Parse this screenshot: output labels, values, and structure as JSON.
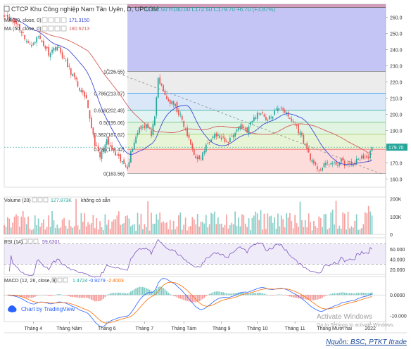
{
  "header": {
    "title": "CTCP Khu Công nghiệp Nam Tân Uyên, D, UPCOM",
    "ohlc": "O172.50  H180.00  L172.50  C179.70  +6.70 (+3.87%)",
    "ma1_label": "MA (20, close, 0)",
    "ma1_value": "171.3150",
    "ma2_label": "MA (50, close, 0)",
    "ma2_value": "180.6213"
  },
  "colors": {
    "up": "#26a69a",
    "down": "#ef5350",
    "ma20": "#3d4bd1",
    "ma50": "#d55e5e",
    "macd": "#2962ff",
    "signal": "#ff6d00",
    "rsi": "#7e57c2"
  },
  "chart_data": [
    {
      "type": "candlestick",
      "title": "CTCP Khu Công nghiệp Nam Tân Uyên, D, UPCOM",
      "ylim": [
        155,
        268
      ],
      "yticks": [
        160,
        170,
        180,
        190,
        200,
        210,
        220,
        230,
        240,
        250,
        260
      ],
      "last_price": 179.7,
      "fib_levels": [
        {
          "ratio": "0",
          "label": "0(163.56)",
          "price": 163.56
        },
        {
          "ratio": "0.236",
          "label": "0.236(178.42)",
          "price": 178.42
        },
        {
          "ratio": "0.382",
          "label": "0.382(187.62)",
          "price": 187.62
        },
        {
          "ratio": "0.5",
          "label": "0.5(195.06)",
          "price": 195.06
        },
        {
          "ratio": "0.618",
          "label": "0.618(202.49)",
          "price": 202.49
        },
        {
          "ratio": "0.786",
          "label": "0.786(213.07)",
          "price": 213.07
        },
        {
          "ratio": "1",
          "label": "1(226.55)",
          "price": 226.55
        }
      ],
      "anchors": [
        {
          "t": 0,
          "p": 262
        },
        {
          "t": 8,
          "p": 255
        },
        {
          "t": 15,
          "p": 242
        },
        {
          "t": 20,
          "p": 248
        },
        {
          "t": 26,
          "p": 238
        },
        {
          "t": 31,
          "p": 242
        },
        {
          "t": 37,
          "p": 230
        },
        {
          "t": 42,
          "p": 220
        },
        {
          "t": 48,
          "p": 208
        },
        {
          "t": 53,
          "p": 182
        },
        {
          "t": 56,
          "p": 174
        },
        {
          "t": 60,
          "p": 183
        },
        {
          "t": 64,
          "p": 176
        },
        {
          "t": 69,
          "p": 170
        },
        {
          "t": 72,
          "p": 168
        },
        {
          "t": 75,
          "p": 180
        },
        {
          "t": 79,
          "p": 192
        },
        {
          "t": 83,
          "p": 193
        },
        {
          "t": 86,
          "p": 188
        },
        {
          "t": 88,
          "p": 197
        },
        {
          "t": 90,
          "p": 222
        },
        {
          "t": 93,
          "p": 214
        },
        {
          "t": 96,
          "p": 208
        },
        {
          "t": 100,
          "p": 205
        },
        {
          "t": 104,
          "p": 196
        },
        {
          "t": 108,
          "p": 184
        },
        {
          "t": 111,
          "p": 176
        },
        {
          "t": 114,
          "p": 171
        },
        {
          "t": 118,
          "p": 180
        },
        {
          "t": 122,
          "p": 188
        },
        {
          "t": 126,
          "p": 186
        },
        {
          "t": 130,
          "p": 182
        },
        {
          "t": 134,
          "p": 188
        },
        {
          "t": 138,
          "p": 193
        },
        {
          "t": 142,
          "p": 190
        },
        {
          "t": 146,
          "p": 198
        },
        {
          "t": 150,
          "p": 202
        },
        {
          "t": 154,
          "p": 196
        },
        {
          "t": 158,
          "p": 201
        },
        {
          "t": 162,
          "p": 205
        },
        {
          "t": 166,
          "p": 198
        },
        {
          "t": 170,
          "p": 194
        },
        {
          "t": 174,
          "p": 186
        },
        {
          "t": 178,
          "p": 176
        },
        {
          "t": 181,
          "p": 168
        },
        {
          "t": 185,
          "p": 166
        },
        {
          "t": 189,
          "p": 170
        },
        {
          "t": 193,
          "p": 169
        },
        {
          "t": 197,
          "p": 171
        },
        {
          "t": 201,
          "p": 168
        },
        {
          "t": 205,
          "p": 170
        },
        {
          "t": 209,
          "p": 174
        },
        {
          "t": 212,
          "p": 172
        },
        {
          "t": 215,
          "p": 179.7
        }
      ]
    },
    {
      "type": "bar",
      "title": "Volume (20)",
      "last_value": "127.873K",
      "status": "không có sẵn",
      "ylim": [
        0,
        210
      ],
      "yticks": [
        {
          "v": 0,
          "label": "0"
        },
        {
          "v": 100,
          "label": "100K"
        },
        {
          "v": 200,
          "label": "200K"
        }
      ]
    },
    {
      "type": "line",
      "title": "RSI (14)",
      "last_value": "59.6301",
      "ylim": [
        10,
        82
      ],
      "band": [
        30,
        70
      ],
      "yticks": [
        {
          "v": 60,
          "label": "60.000"
        },
        {
          "v": 40,
          "label": "40.000"
        },
        {
          "v": 20,
          "label": "20.000"
        }
      ]
    },
    {
      "type": "line",
      "title": "MACD (12, 26, close, 9)",
      "values": [
        "1.4724",
        "-0.9279",
        "-2.4003"
      ],
      "ylim": [
        -13,
        9
      ],
      "yticks": [
        {
          "v": 0,
          "label": "0.0000"
        },
        {
          "v": -10,
          "label": "-10.000"
        }
      ]
    }
  ],
  "time_axis": {
    "labels": [
      {
        "t": 17,
        "label": "Tháng 4"
      },
      {
        "t": 38,
        "label": "Tháng Năm"
      },
      {
        "t": 60,
        "label": "Tháng 6"
      },
      {
        "t": 82,
        "label": "Tháng 7"
      },
      {
        "t": 105,
        "label": "Tháng Tám"
      },
      {
        "t": 127,
        "label": "Tháng 9"
      },
      {
        "t": 148,
        "label": "Tháng 10"
      },
      {
        "t": 170,
        "label": "Tháng 11"
      },
      {
        "t": 193,
        "label": "Tháng Mười hai"
      },
      {
        "t": 214,
        "label": "2022"
      }
    ]
  },
  "watermark": {
    "line1": "Activate Windows",
    "line2": "Go to Settings to activate Windows."
  },
  "brand": "Chart by TradingView",
  "source": "Nguồn: BSC, PTKT Itrade"
}
